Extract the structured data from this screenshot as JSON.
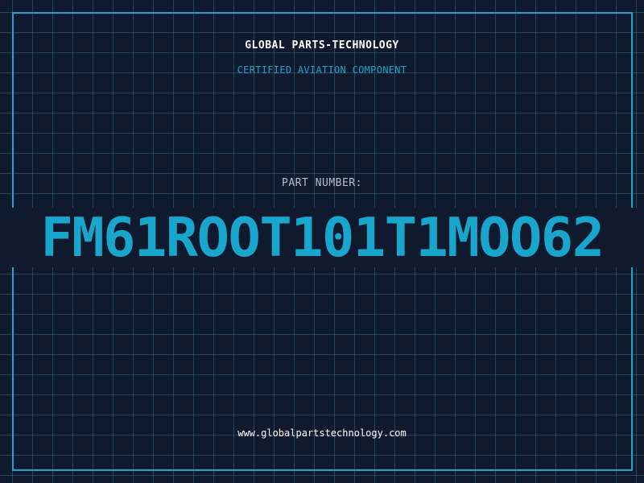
{
  "header": {
    "company": "GLOBAL PARTS-TECHNOLOGY",
    "tagline": "CERTIFIED AVIATION COMPONENT"
  },
  "part": {
    "label": "PART NUMBER:",
    "number": "FM61ROOT101T1MOO62"
  },
  "footer": {
    "url": "www.globalpartstechnology.com"
  },
  "colors": {
    "background": "#101a2e",
    "accent": "#19a6cc",
    "grid": "#3c7896",
    "text_primary": "#ffffff",
    "text_secondary": "#b6bfcc"
  }
}
